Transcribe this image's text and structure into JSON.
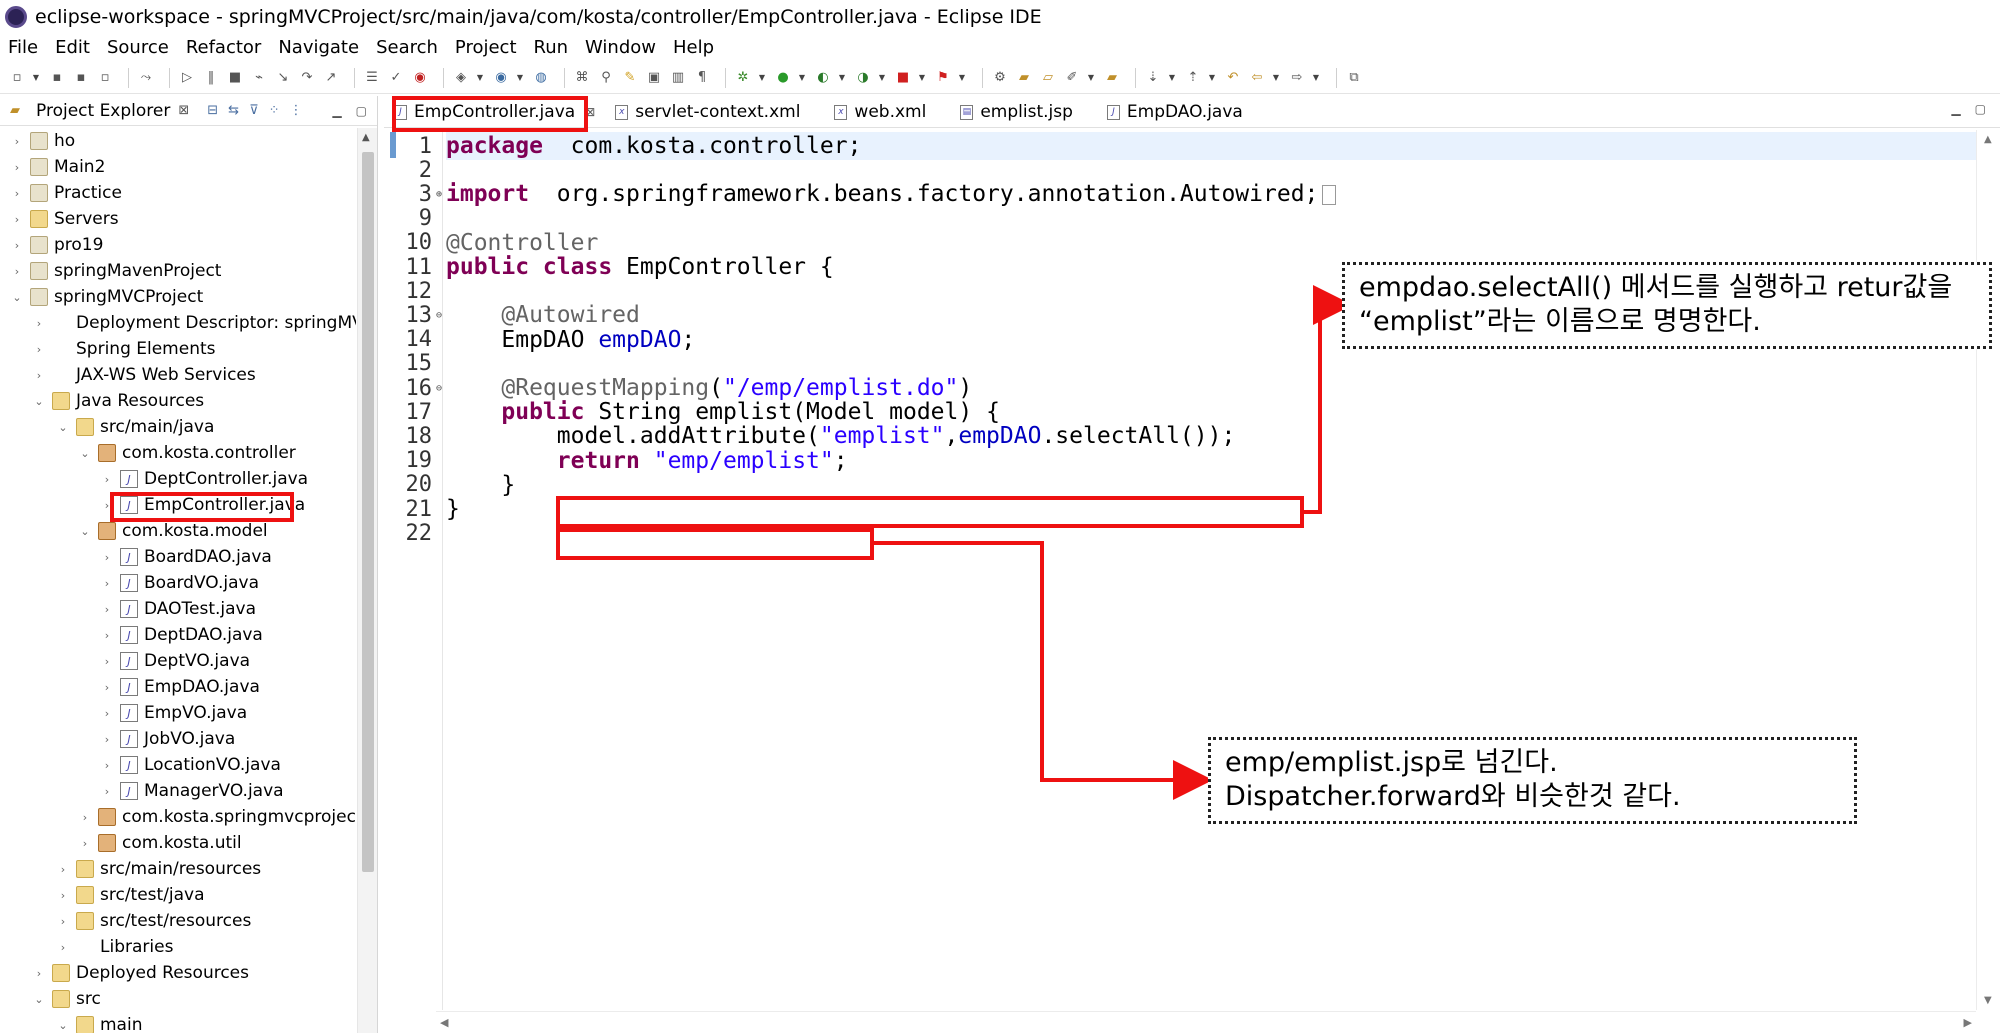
{
  "window": {
    "title": "eclipse-workspace - springMVCProject/src/main/java/com/kosta/controller/EmpController.java - Eclipse IDE"
  },
  "menu": [
    "File",
    "Edit",
    "Source",
    "Refactor",
    "Navigate",
    "Search",
    "Project",
    "Run",
    "Window",
    "Help"
  ],
  "project_explorer": {
    "title": "Project Explorer",
    "close_glyph": "⊠",
    "items": [
      {
        "label": "ho",
        "twisty": "›",
        "icon": "proj"
      },
      {
        "label": "Main2",
        "twisty": "›",
        "icon": "proj"
      },
      {
        "label": "Practice",
        "twisty": "›",
        "icon": "proj"
      },
      {
        "label": "Servers",
        "twisty": "›",
        "icon": "folder"
      },
      {
        "label": "pro19",
        "twisty": "›",
        "icon": "proj"
      },
      {
        "label": "springMavenProject",
        "twisty": "›",
        "icon": "proj"
      },
      {
        "label": "springMVCProject",
        "twisty": "⌄",
        "icon": "proj"
      },
      {
        "label": "Deployment Descriptor: springMVCP",
        "twisty": "›",
        "icon": "dd"
      },
      {
        "label": "Spring Elements",
        "twisty": "›",
        "icon": "green"
      },
      {
        "label": "JAX-WS Web Services",
        "twisty": "›",
        "icon": "dd"
      },
      {
        "label": "Java Resources",
        "twisty": "⌄",
        "icon": "folder"
      },
      {
        "label": "src/main/java",
        "twisty": "⌄",
        "icon": "folder"
      },
      {
        "label": "com.kosta.controller",
        "twisty": "⌄",
        "icon": "pkg"
      },
      {
        "label": "DeptController.java",
        "twisty": "›",
        "icon": "javafile"
      },
      {
        "label": "EmpController.java",
        "twisty": "›",
        "icon": "javafile"
      },
      {
        "label": "com.kosta.model",
        "twisty": "⌄",
        "icon": "pkg"
      },
      {
        "label": "BoardDAO.java",
        "twisty": "›",
        "icon": "javafile"
      },
      {
        "label": "BoardVO.java",
        "twisty": "›",
        "icon": "javafile"
      },
      {
        "label": "DAOTest.java",
        "twisty": "›",
        "icon": "javafile"
      },
      {
        "label": "DeptDAO.java",
        "twisty": "›",
        "icon": "javafile"
      },
      {
        "label": "DeptVO.java",
        "twisty": "›",
        "icon": "javafile"
      },
      {
        "label": "EmpDAO.java",
        "twisty": "›",
        "icon": "javafile"
      },
      {
        "label": "EmpVO.java",
        "twisty": "›",
        "icon": "javafile"
      },
      {
        "label": "JobVO.java",
        "twisty": "›",
        "icon": "javafile"
      },
      {
        "label": "LocationVO.java",
        "twisty": "›",
        "icon": "javafile"
      },
      {
        "label": "ManagerVO.java",
        "twisty": "›",
        "icon": "javafile"
      },
      {
        "label": "com.kosta.springmvcproject",
        "twisty": "›",
        "icon": "pkg"
      },
      {
        "label": "com.kosta.util",
        "twisty": "›",
        "icon": "pkg"
      },
      {
        "label": "src/main/resources",
        "twisty": "›",
        "icon": "folder"
      },
      {
        "label": "src/test/java",
        "twisty": "›",
        "icon": "folder"
      },
      {
        "label": "src/test/resources",
        "twisty": "›",
        "icon": "folder"
      },
      {
        "label": "Libraries",
        "twisty": "›",
        "icon": "lib"
      },
      {
        "label": "Deployed Resources",
        "twisty": "›",
        "icon": "folder"
      },
      {
        "label": "src",
        "twisty": "⌄",
        "icon": "folder"
      },
      {
        "label": "main",
        "twisty": "⌄",
        "icon": "folder"
      }
    ]
  },
  "editor": {
    "tabs": [
      {
        "label": "EmpController.java",
        "icon": "J",
        "close": "⊠",
        "active": true
      },
      {
        "label": "servlet-context.xml",
        "icon": "x",
        "close": "",
        "active": false
      },
      {
        "label": "web.xml",
        "icon": "x",
        "close": "",
        "active": false
      },
      {
        "label": "emplist.jsp",
        "icon": "▤",
        "close": "",
        "active": false
      },
      {
        "label": "EmpDAO.java",
        "icon": "J",
        "close": "",
        "active": false
      }
    ],
    "lines": [
      {
        "n": "1",
        "fold": "",
        "t": [
          [
            "kw",
            "package"
          ],
          [
            "",
            "  com.kosta.controller;"
          ]
        ]
      },
      {
        "n": "2",
        "fold": "",
        "t": []
      },
      {
        "n": "3",
        "fold": "⊕",
        "t": [
          [
            "kw",
            "import"
          ],
          [
            "",
            "  org.springframework.beans.factory.annotation.Autowired;"
          ]
        ]
      },
      {
        "n": "9",
        "fold": "",
        "t": []
      },
      {
        "n": "10",
        "fold": "",
        "t": [
          [
            "ann",
            "@Controller"
          ]
        ]
      },
      {
        "n": "11",
        "fold": "",
        "t": [
          [
            "kw",
            "public class"
          ],
          [
            "",
            " EmpController {"
          ]
        ]
      },
      {
        "n": "12",
        "fold": "",
        "t": []
      },
      {
        "n": "13",
        "fold": "⊖",
        "t": [
          [
            "",
            "    "
          ],
          [
            "ann",
            "@Autowired"
          ]
        ]
      },
      {
        "n": "14",
        "fold": "",
        "t": [
          [
            "",
            "    EmpDAO "
          ],
          [
            "fld",
            "empDAO"
          ],
          [
            "",
            ";"
          ]
        ]
      },
      {
        "n": "15",
        "fold": "",
        "t": []
      },
      {
        "n": "16",
        "fold": "⊖",
        "t": [
          [
            "",
            "    "
          ],
          [
            "ann",
            "@RequestMapping"
          ],
          [
            "",
            "("
          ],
          [
            "str",
            "\"/emp/emplist.do\""
          ],
          [
            "",
            ")"
          ]
        ]
      },
      {
        "n": "17",
        "fold": "",
        "t": [
          [
            "",
            "    "
          ],
          [
            "kw",
            "public"
          ],
          [
            "",
            " String emplist(Model "
          ],
          [
            "",
            "model"
          ],
          [
            "",
            ") {"
          ]
        ]
      },
      {
        "n": "18",
        "fold": "",
        "t": [
          [
            "",
            "        model.addAttribute("
          ],
          [
            "str",
            "\"emplist\""
          ],
          [
            "",
            ","
          ],
          [
            "fld",
            "empDAO"
          ],
          [
            "",
            ".selectAll());"
          ]
        ]
      },
      {
        "n": "19",
        "fold": "",
        "t": [
          [
            "",
            "        "
          ],
          [
            "kw",
            "return"
          ],
          [
            "",
            " "
          ],
          [
            "str",
            "\"emp/emplist\""
          ],
          [
            "",
            ";"
          ]
        ]
      },
      {
        "n": "20",
        "fold": "",
        "t": [
          [
            "",
            "    }"
          ]
        ]
      },
      {
        "n": "21",
        "fold": "",
        "t": [
          [
            "",
            "}"
          ]
        ]
      },
      {
        "n": "22",
        "fold": "",
        "t": []
      }
    ]
  },
  "annotations": {
    "note1": {
      "line1": "empdao.selectAll() 메서드를 실행하고 retur값을",
      "line2": "“emplist”라는 이름으로 명명한다."
    },
    "note2": {
      "line1": "emp/emplist.jsp로 넘긴다.",
      "line2": "Dispatcher.forward와 비슷한것 같다."
    },
    "highlight_color": "#ee1111"
  },
  "colors": {
    "keyword": "#7f0055",
    "string": "#2a00ff",
    "annotation": "#646464",
    "field": "#0000c0"
  }
}
